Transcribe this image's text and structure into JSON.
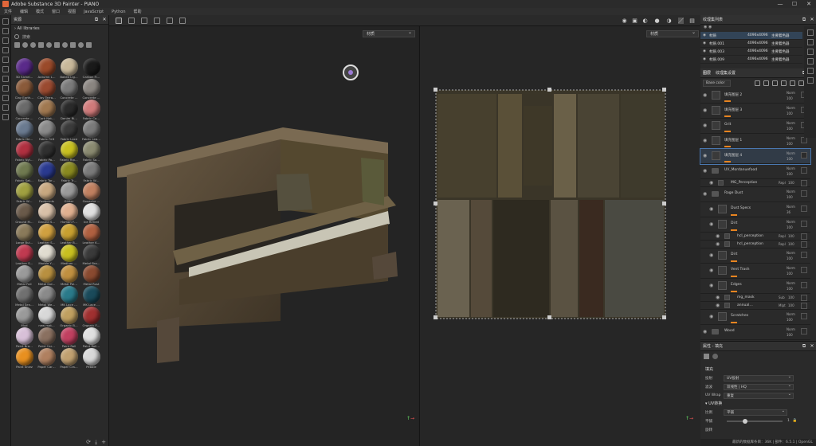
{
  "app": {
    "title": "Adobe Substance 3D Painter - PIANO"
  },
  "window_controls": [
    "—",
    "☐",
    "✕"
  ],
  "menu": [
    "文件",
    "编辑",
    "模式",
    "窗口",
    "视图",
    "JavaScript",
    "Python",
    "帮助"
  ],
  "shelf": {
    "title": "资源",
    "path": "All libraries",
    "search_placeholder": "搜索",
    "materials": [
      {
        "label": "3D Sichel…",
        "color": "#5a2a8a"
      },
      {
        "label": "Autumn L…",
        "color": "#9a4a2a"
      },
      {
        "label": "Baked Lig…",
        "color": "#c8b89a"
      },
      {
        "label": "Carbon Fi…",
        "color": "#1a1a1a"
      },
      {
        "label": "Clay Earth…",
        "color": "#8a5a3a"
      },
      {
        "label": "Clay Terra…",
        "color": "#9a4a30"
      },
      {
        "label": "Concrete …",
        "color": "#7a7a7a"
      },
      {
        "label": "Concrete …",
        "color": "#8a8580"
      },
      {
        "label": "Concrete …",
        "color": "#6a6a6a"
      },
      {
        "label": "Cork Nat…",
        "color": "#a07850"
      },
      {
        "label": "Denim Ri…",
        "color": "#2a2a2a"
      },
      {
        "label": "Fabric Co…",
        "color": "#d07a7a"
      },
      {
        "label": "Fabric De…",
        "color": "#6a7a90"
      },
      {
        "label": "Fabric Felt",
        "color": "#8a8a8a"
      },
      {
        "label": "Fabric Lace",
        "color": "#3a3a3a"
      },
      {
        "label": "Fabric Lea…",
        "color": "#7a7a7a"
      },
      {
        "label": "Fabric Nyl…",
        "color": "#b03040"
      },
      {
        "label": "Fabric Pa…",
        "color": "#303030"
      },
      {
        "label": "Fabric Rip…",
        "color": "#c8c020"
      },
      {
        "label": "Fabric So…",
        "color": "#8a8a70"
      },
      {
        "label": "Fabric Sat…",
        "color": "#707a50"
      },
      {
        "label": "Fabric Tar…",
        "color": "#2a3a90"
      },
      {
        "label": "Fabric Tr…",
        "color": "#8a8a20"
      },
      {
        "label": "Fabric W…",
        "color": "#7a7a7a"
      },
      {
        "label": "Fabric W…",
        "color": "#a0a040"
      },
      {
        "label": "Footprints",
        "color": "#c8a880"
      },
      {
        "label": "Glitter",
        "color": "#9a9a9a"
      },
      {
        "label": "Gouache …",
        "color": "#c08060"
      },
      {
        "label": "Ground M…",
        "color": "#6a5a4a"
      },
      {
        "label": "Ground S…",
        "color": "#d8c0a8"
      },
      {
        "label": "Human F…",
        "color": "#e0b090"
      },
      {
        "label": "Ice Rimed",
        "color": "#e0e0e0"
      },
      {
        "label": "Large Bul…",
        "color": "#8a7a5a"
      },
      {
        "label": "Leather S…",
        "color": "#d0a040"
      },
      {
        "label": "Leather B…",
        "color": "#c8a030"
      },
      {
        "label": "Leather K…",
        "color": "#b06040"
      },
      {
        "label": "Leather S…",
        "color": "#c03a50"
      },
      {
        "label": "Marble Y…",
        "color": "#e0dcd0"
      },
      {
        "label": "Medium …",
        "color": "#c8c020"
      },
      {
        "label": "Metal Bra…",
        "color": "#3a3a3a"
      },
      {
        "label": "Metal Foil",
        "color": "#9a9a9a"
      },
      {
        "label": "Metal Gol…",
        "color": "#b89040"
      },
      {
        "label": "Metal Pol…",
        "color": "#c09040"
      },
      {
        "label": "Metal Rust",
        "color": "#8a4a30"
      },
      {
        "label": "Metal Sen…",
        "color": "#707070"
      },
      {
        "label": "Metal We…",
        "color": "#8a8a8a"
      },
      {
        "label": "MK Lace …",
        "color": "#2a7a8a"
      },
      {
        "label": "MK Lace …",
        "color": "#1a4a5a"
      },
      {
        "label": "Mud",
        "color": "#9a9a9a"
      },
      {
        "label": "new mat…",
        "color": "#d8d8d8"
      },
      {
        "label": "Organic B…",
        "color": "#c0a060"
      },
      {
        "label": "Organic F…",
        "color": "#a03030"
      },
      {
        "label": "Paint Bra…",
        "color": "#d8c0d8"
      },
      {
        "label": "Paint Car…",
        "color": "#8a7060"
      },
      {
        "label": "Paint Roll",
        "color": "#c04060"
      },
      {
        "label": "Paint Roll…",
        "color": "#e0e0e0"
      },
      {
        "label": "Paint Sniez",
        "color": "#e89020"
      },
      {
        "label": "Paper Car…",
        "color": "#b08060"
      },
      {
        "label": "Paper Cra…",
        "color": "#c0a070"
      },
      {
        "label": "Pebble",
        "color": "#d8d8d8"
      }
    ]
  },
  "viewport": {
    "left_dropdown": "材质",
    "right_dropdown": "材质"
  },
  "texture_sets": {
    "title": "纹理集列表",
    "rows": [
      {
        "name": "材质",
        "resolution": "4096x4096",
        "shader": "主要着色器"
      },
      {
        "name": "材质.001",
        "resolution": "4096x4096",
        "shader": "主要着色器"
      },
      {
        "name": "材质.003",
        "resolution": "4096x4096",
        "shader": "主要着色器"
      },
      {
        "name": "材质.009",
        "resolution": "4096x4096",
        "shader": "主要着色器"
      }
    ]
  },
  "layers": {
    "tab1": "图层",
    "tab2": "纹理集设置",
    "blend_mode": "Base color",
    "items": [
      {
        "name": "填充图层 2",
        "mode": "Norm",
        "value": "100",
        "indent": 0,
        "kind": "layer"
      },
      {
        "name": "填充图层 3",
        "mode": "Norm",
        "value": "100",
        "indent": 0,
        "kind": "layer"
      },
      {
        "name": "Grit",
        "mode": "Norm",
        "value": "100",
        "indent": 0,
        "kind": "layer"
      },
      {
        "name": "填充图层 1",
        "mode": "Norm",
        "value": "100",
        "indent": 0,
        "kind": "layer"
      },
      {
        "name": "填充图层 4",
        "mode": "Norm",
        "value": "100",
        "indent": 0,
        "kind": "layer",
        "selected": true
      },
      {
        "name": "UV_Mordanuefood",
        "mode": "Norm",
        "value": "100",
        "indent": 0,
        "kind": "folder"
      },
      {
        "name": "MG_Perception",
        "mode": "Repl",
        "value": "100",
        "indent": 1,
        "kind": "mask"
      },
      {
        "name": "Rage Dust",
        "mode": "Norm",
        "value": "100",
        "indent": 0,
        "kind": "folder"
      },
      {
        "name": "Dust Specs",
        "mode": "Norm",
        "value": "36",
        "indent": 1,
        "kind": "layer"
      },
      {
        "name": "Dirt",
        "mode": "Norm",
        "value": "100",
        "indent": 1,
        "kind": "layer"
      },
      {
        "name": "hcl_perception",
        "mode": "Repl",
        "value": "100",
        "indent": 2,
        "kind": "mask"
      },
      {
        "name": "hcl_perception",
        "mode": "Repl",
        "value": "100",
        "indent": 2,
        "kind": "mask"
      },
      {
        "name": "Dirt",
        "mode": "Norm",
        "value": "100",
        "indent": 1,
        "kind": "layer"
      },
      {
        "name": "Vent Trash",
        "mode": "Norm",
        "value": "100",
        "indent": 1,
        "kind": "layer"
      },
      {
        "name": "Edges",
        "mode": "Norm",
        "value": "100",
        "indent": 1,
        "kind": "layer"
      },
      {
        "name": "mg_mask",
        "mode": "Sub",
        "value": "100",
        "indent": 2,
        "kind": "mask"
      },
      {
        "name": "annual…",
        "mode": "Mlpt",
        "value": "100",
        "indent": 2,
        "kind": "mask"
      },
      {
        "name": "Scratches",
        "mode": "Norm",
        "value": "100",
        "indent": 1,
        "kind": "layer"
      },
      {
        "name": "Wood",
        "mode": "Norm",
        "value": "100",
        "indent": 0,
        "kind": "folder"
      }
    ]
  },
  "properties": {
    "title": "属性 - 填充",
    "section": "填充",
    "rows": [
      {
        "label": "投射",
        "value": "UV投射"
      },
      {
        "label": "滤波",
        "value": "双线性 | HQ"
      },
      {
        "label": "UV Wrap",
        "value": "重复"
      }
    ],
    "uv_section": "UV转换",
    "scale_label": "比例",
    "scale_value": "平铺",
    "tiling_label": "平铺",
    "tiling_value": "1",
    "rotate_label": "旋转"
  },
  "status": "最新的数据库条目：36K | 部件：6.5.1 | OpenGL"
}
